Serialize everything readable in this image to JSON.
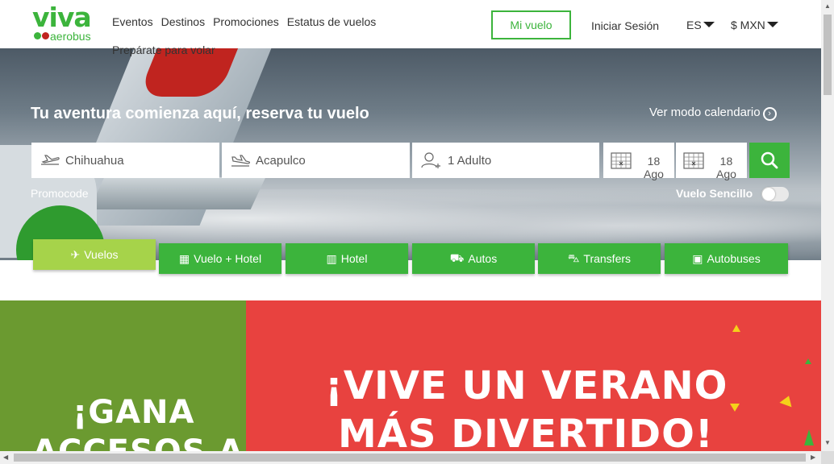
{
  "header": {
    "logo_text": "viva",
    "logo_sub": "aerobus",
    "nav": [
      "Eventos",
      "Destinos",
      "Promociones",
      "Estatus de vuelos",
      "Prepárate para volar"
    ],
    "mi_vuelo": "Mi vuelo",
    "login": "Iniciar Sesión",
    "language": "ES",
    "currency": "$ MXN"
  },
  "hero": {
    "title": "Tu aventura comienza aquí, reserva tu vuelo",
    "calendar_mode": "Ver modo calendario",
    "origin": "Chihuahua",
    "destination": "Acapulco",
    "passengers": "1 Adulto",
    "depart_day": "18",
    "depart_month": "Ago",
    "return_day": "18",
    "return_month": "Ago",
    "promocode": "Promocode",
    "one_way": "Vuelo Sencillo"
  },
  "tabs": [
    {
      "label": "Vuelos",
      "icon": "plane-icon",
      "active": true
    },
    {
      "label": "Vuelo + Hotel",
      "icon": "building-icon",
      "active": false
    },
    {
      "label": "Hotel",
      "icon": "hotel-icon",
      "active": false
    },
    {
      "label": "Autos",
      "icon": "car-icon",
      "active": false
    },
    {
      "label": "Transfers",
      "icon": "taxi-icon",
      "active": false
    },
    {
      "label": "Autobuses",
      "icon": "bus-icon",
      "active": false
    }
  ],
  "promo": {
    "left_line1": "¡GANA",
    "left_line2": "ACCESOS A",
    "right_line1": "¡VIVE UN VERANO",
    "right_line2": "MÁS DIVERTIDO!"
  },
  "colors": {
    "brand_green": "#3cb43c",
    "active_tab": "#a6d34a",
    "promo_green": "#6b9a30",
    "promo_red": "#e8423f",
    "brand_red": "#c0241f"
  }
}
